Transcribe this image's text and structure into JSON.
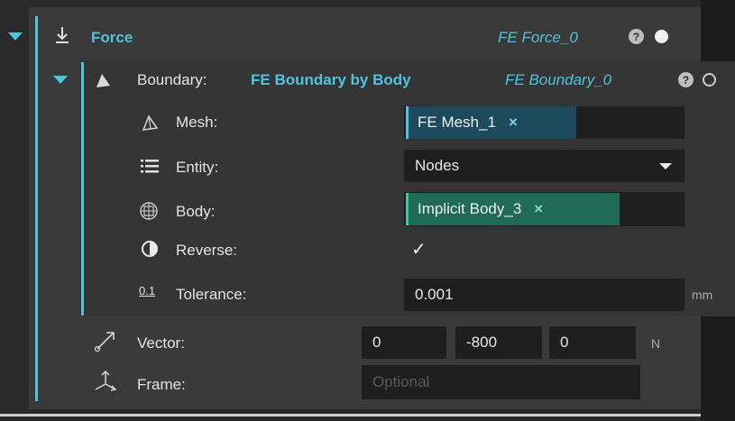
{
  "force": {
    "label": "Force",
    "name": "FE Force_0",
    "help": "?"
  },
  "boundary": {
    "label": "Boundary:",
    "type": "FE Boundary by Body",
    "name": "FE Boundary_0",
    "help": "?",
    "rows": {
      "mesh": {
        "label": "Mesh:",
        "value": "FE Mesh_1",
        "remove": "×"
      },
      "entity": {
        "label": "Entity:",
        "value": "Nodes"
      },
      "body": {
        "label": "Body:",
        "value": "Implicit Body_3",
        "remove": "×"
      },
      "reverse": {
        "label": "Reverse:",
        "value": "✓"
      },
      "tolerance": {
        "label": "Tolerance:",
        "icon_text": "0.1",
        "value": "0.001",
        "unit": "mm"
      }
    }
  },
  "vector": {
    "label": "Vector:",
    "values": [
      "0",
      "-800",
      "0"
    ],
    "unit": "N"
  },
  "frame": {
    "label": "Frame:",
    "placeholder": "Optional"
  },
  "colors": {
    "accent": "#4fc3df",
    "mesh_chip": "#1d4a5c",
    "body_chip": "#1f6b55"
  }
}
